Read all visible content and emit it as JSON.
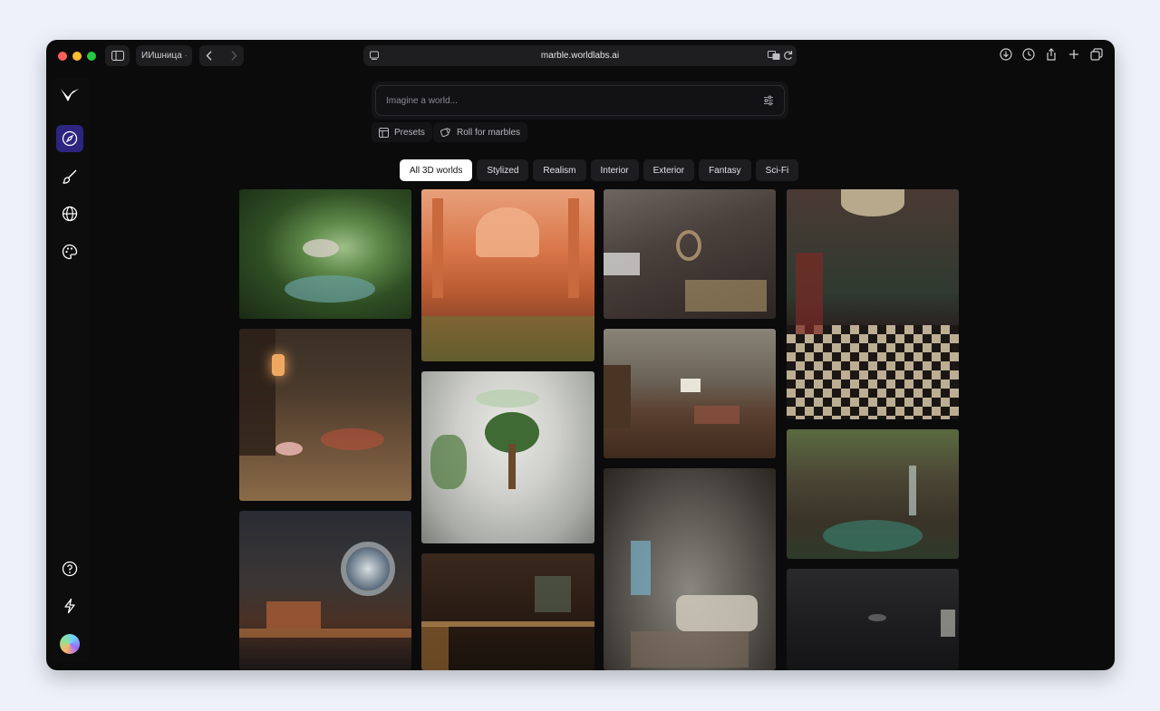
{
  "browser": {
    "profile_label": "ИИшница",
    "url": "marble.worldlabs.ai"
  },
  "rail": {
    "items": [
      {
        "icon": "logo-icon"
      },
      {
        "icon": "compass-icon",
        "active": true
      },
      {
        "icon": "brush-icon"
      },
      {
        "icon": "globe-icon"
      },
      {
        "icon": "palette-icon"
      },
      {
        "icon": "help-icon"
      },
      {
        "icon": "lightning-icon"
      }
    ]
  },
  "prompt": {
    "placeholder": "Imagine a world..."
  },
  "actions": {
    "presets_label": "Presets",
    "roll_label": "Roll for marbles"
  },
  "tabs": [
    "All 3D worlds",
    "Stylized",
    "Realism",
    "Interior",
    "Exterior",
    "Fantasy",
    "Sci-Fi"
  ],
  "active_tab": "All 3D worlds",
  "gallery": [
    {
      "name": "jungle-pods"
    },
    {
      "name": "orange-palace"
    },
    {
      "name": "study-room"
    },
    {
      "name": "checkered-hall"
    },
    {
      "name": "library-lantern"
    },
    {
      "name": "white-cave-bonsai"
    },
    {
      "name": "rustic-bedroom"
    },
    {
      "name": "ruined-courtyard"
    },
    {
      "name": "spaceship-room"
    },
    {
      "name": "wood-kitchen"
    },
    {
      "name": "cave-bedroom"
    },
    {
      "name": "dark-hall"
    }
  ],
  "colors": {
    "accent": "#2d2580",
    "background": "#0b0b0c",
    "page": "#eef1fa"
  }
}
